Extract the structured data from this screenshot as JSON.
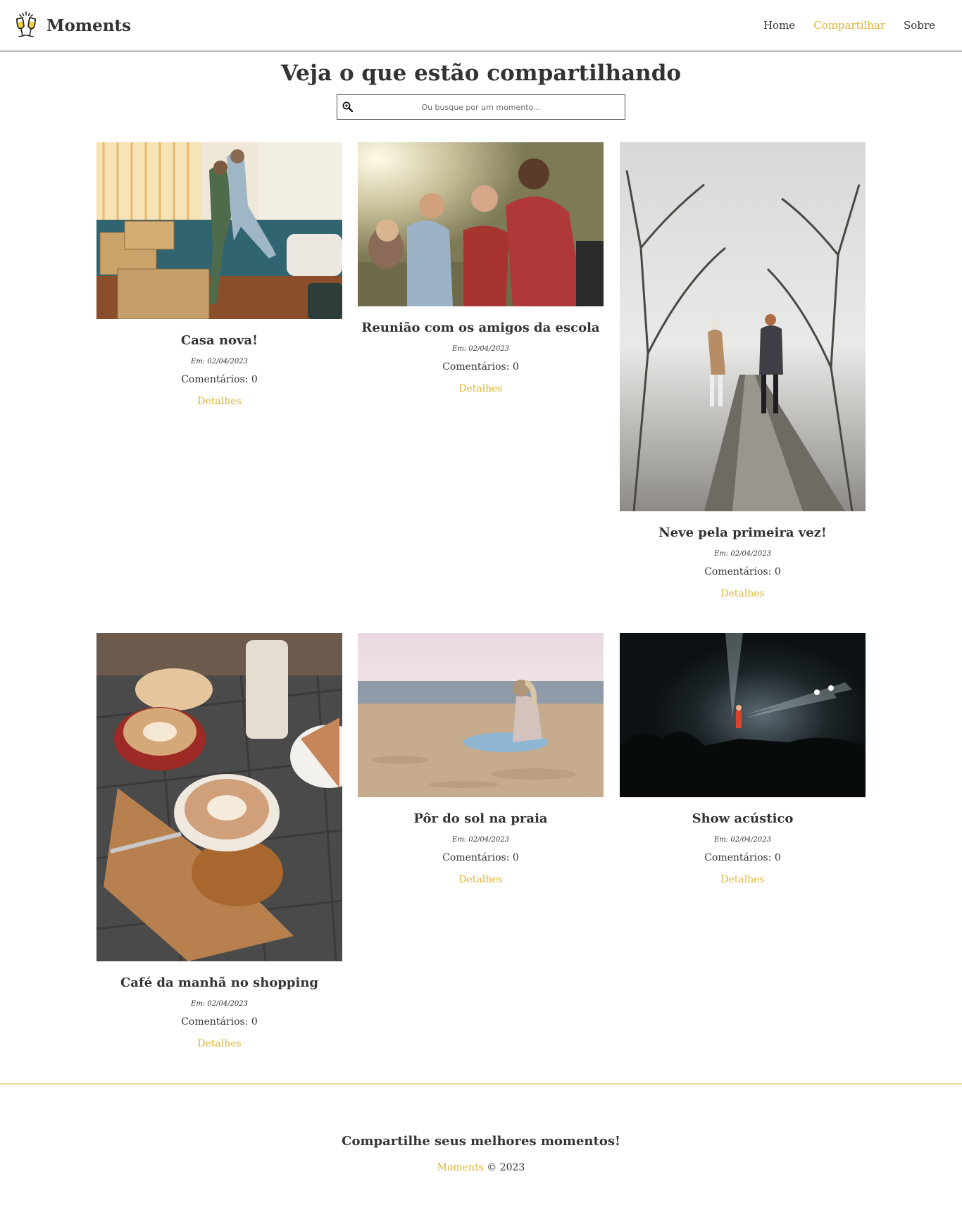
{
  "navbar": {
    "brand": "Moments",
    "links": [
      {
        "label": "Home",
        "active": false
      },
      {
        "label": "Compartilhar",
        "active": true
      },
      {
        "label": "Sobre",
        "active": false
      }
    ]
  },
  "header": {
    "title": "Veja o que estão compartilhando",
    "search_placeholder": "Ou busque por um momento..."
  },
  "moments": [
    {
      "title": "Casa nova!",
      "date": "Em: 02/04/2023",
      "comments": "Comentários: 0",
      "details": "Detalhes"
    },
    {
      "title": "Reunião com os amigos da escola",
      "date": "Em: 02/04/2023",
      "comments": "Comentários: 0",
      "details": "Detalhes"
    },
    {
      "title": "Neve pela primeira vez!",
      "date": "Em: 02/04/2023",
      "comments": "Comentários: 0",
      "details": "Detalhes"
    },
    {
      "title": "Café da manhã no shopping",
      "date": "Em: 02/04/2023",
      "comments": "Comentários: 0",
      "details": "Detalhes"
    },
    {
      "title": "Pôr do sol na praia",
      "date": "Em: 02/04/2023",
      "comments": "Comentários: 0",
      "details": "Detalhes"
    },
    {
      "title": "Show acústico",
      "date": "Em: 02/04/2023",
      "comments": "Comentários: 0",
      "details": "Detalhes"
    }
  ],
  "footer": {
    "slogan": "Compartilhe seus melhores momentos!",
    "brand": "Moments",
    "copyright": "© 2023"
  },
  "colors": {
    "accent": "#e0b433",
    "text": "#333333"
  }
}
